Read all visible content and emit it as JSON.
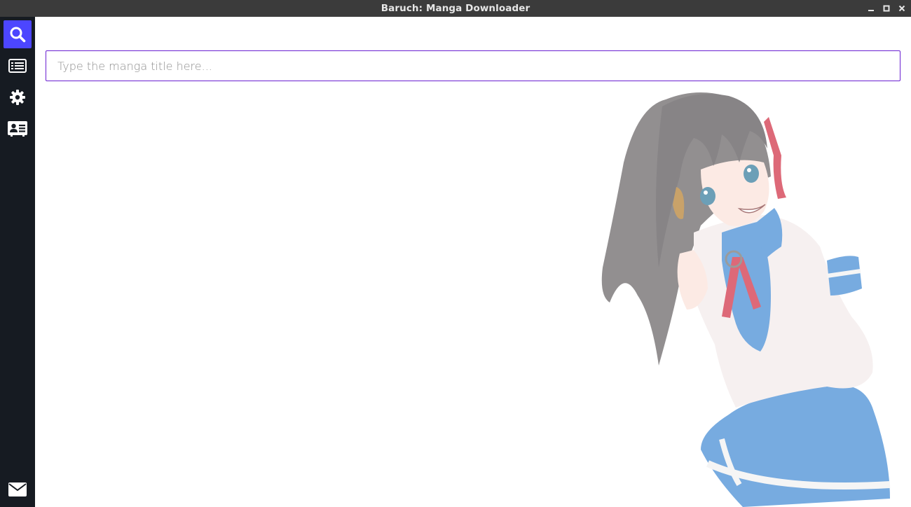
{
  "window": {
    "title": "Baruch: Manga Downloader",
    "controls": [
      "minimize-icon",
      "maximize-icon",
      "close-icon"
    ]
  },
  "sidebar": {
    "items": [
      {
        "icon": "search-icon",
        "active": true
      },
      {
        "icon": "list-icon",
        "active": false
      },
      {
        "icon": "gear-icon",
        "active": false
      },
      {
        "icon": "id-card-icon",
        "active": false
      }
    ],
    "footer_icon": "envelope-icon"
  },
  "search": {
    "placeholder": "Type the manga title here...",
    "value": ""
  },
  "colors": {
    "titlebar": "#3b3b3b",
    "sidebar": "#161b22",
    "accent": "#4c46ff",
    "input_border": "#6a1fd1"
  },
  "background_image": "anime-schoolgirl-illustration"
}
